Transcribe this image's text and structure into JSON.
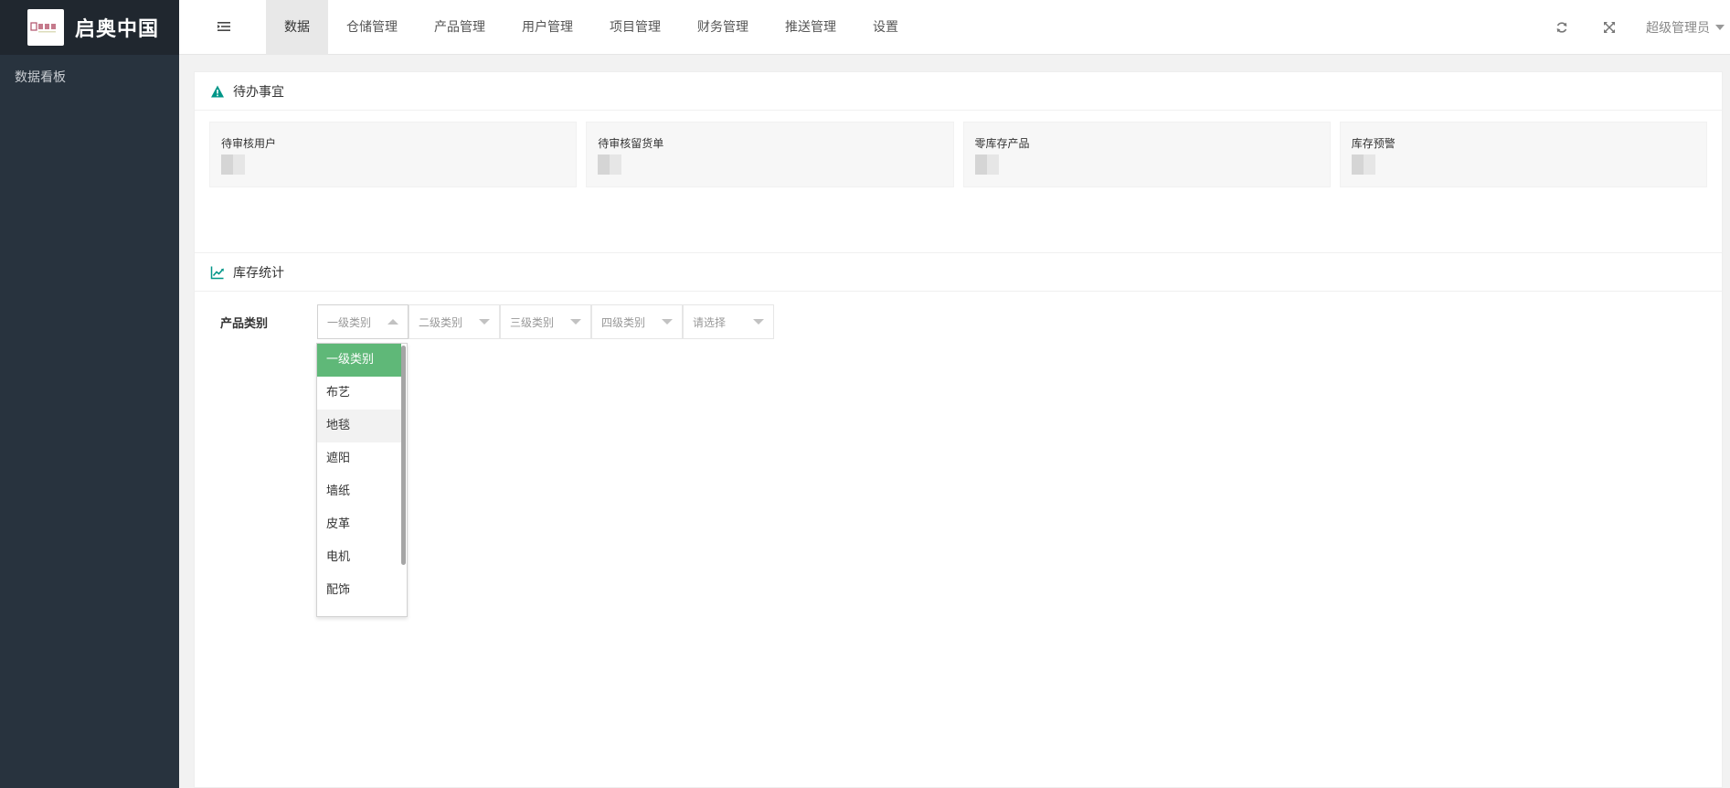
{
  "app": {
    "name": "启奥中国"
  },
  "sidebar": {
    "items": [
      {
        "label": "数据看板"
      }
    ]
  },
  "header": {
    "nav": [
      {
        "label": "数据",
        "active": true
      },
      {
        "label": "仓储管理"
      },
      {
        "label": "产品管理"
      },
      {
        "label": "用户管理"
      },
      {
        "label": "项目管理"
      },
      {
        "label": "财务管理"
      },
      {
        "label": "推送管理"
      },
      {
        "label": "设置"
      }
    ],
    "user": "超级管理员",
    "icons": [
      "refresh-icon",
      "fullscreen-icon"
    ]
  },
  "todo": {
    "title": "待办事宜",
    "cards": [
      {
        "title": "待审核用户"
      },
      {
        "title": "待审核留货单"
      },
      {
        "title": "零库存产品"
      },
      {
        "title": "库存预警"
      }
    ]
  },
  "stats": {
    "title": "库存统计",
    "filter_label": "产品类别",
    "selects": [
      {
        "placeholder": "一级类别"
      },
      {
        "placeholder": "二级类别"
      },
      {
        "placeholder": "三级类别"
      },
      {
        "placeholder": "四级类别"
      },
      {
        "placeholder": "请选择"
      }
    ],
    "dropdown": {
      "options": [
        "一级类别",
        "布艺",
        "地毯",
        "遮阳",
        "墙纸",
        "皮革",
        "电机",
        "配饰"
      ],
      "selected_index": 0,
      "hover_index": 2
    }
  },
  "colors": {
    "sidebar_bg": "#28333e",
    "logo_bg": "#20272f",
    "accent_green": "#5fb878",
    "icon_teal": "#009688"
  }
}
